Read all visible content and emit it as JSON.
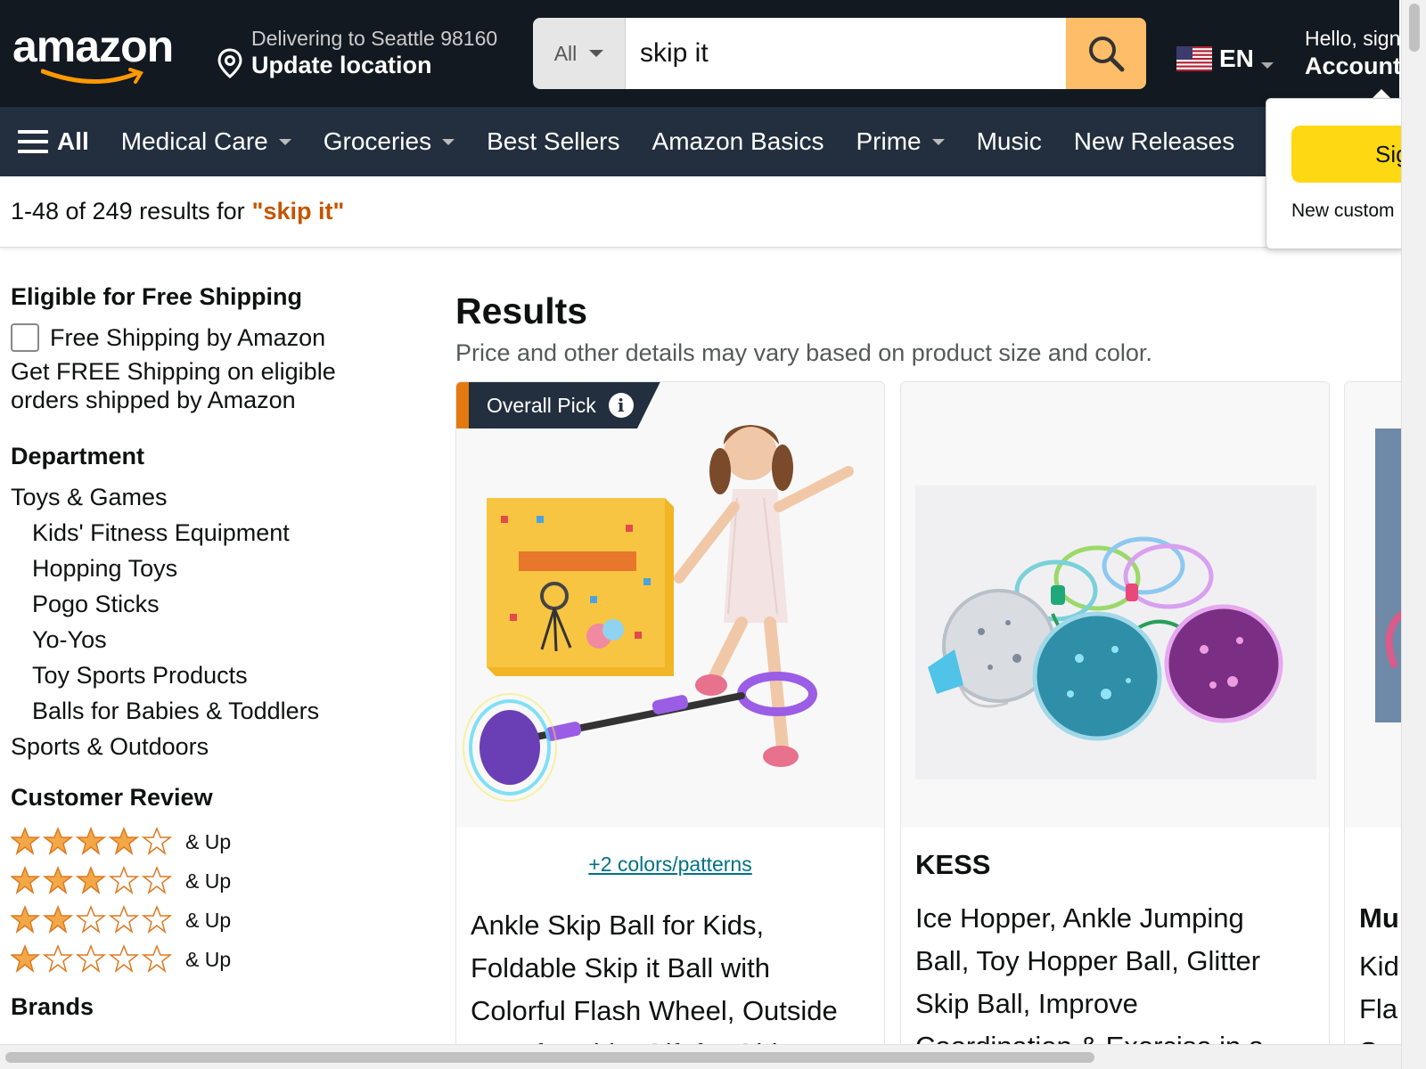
{
  "header": {
    "logo": "amazon",
    "deliver_line": "Delivering to Seattle 98160",
    "update_location": "Update location",
    "search_category": "All",
    "search_value": "skip it",
    "language": "EN",
    "greeting": "Hello, sign",
    "account": "Account"
  },
  "nav": {
    "all_label": "All",
    "items": [
      {
        "label": "Medical Care",
        "dropdown": true
      },
      {
        "label": "Groceries",
        "dropdown": true
      },
      {
        "label": "Best Sellers",
        "dropdown": false
      },
      {
        "label": "Amazon Basics",
        "dropdown": false
      },
      {
        "label": "Prime",
        "dropdown": true
      },
      {
        "label": "Music",
        "dropdown": false
      },
      {
        "label": "New Releases",
        "dropdown": false
      }
    ]
  },
  "popover": {
    "signin_button": "Sig",
    "new_customer": "New custom"
  },
  "results_bar": {
    "count_text": "1-48 of 249 results for",
    "query": "\"skip it\""
  },
  "sidebar": {
    "shipping_heading": "Eligible for Free Shipping",
    "shipping_checkbox": "Free Shipping by Amazon",
    "shipping_desc": "Get FREE Shipping on eligible orders shipped by Amazon",
    "department_heading": "Department",
    "departments": [
      {
        "label": "Toys & Games",
        "sub": false
      },
      {
        "label": "Kids' Fitness Equipment",
        "sub": true
      },
      {
        "label": "Hopping Toys",
        "sub": true
      },
      {
        "label": "Pogo Sticks",
        "sub": true
      },
      {
        "label": "Yo-Yos",
        "sub": true
      },
      {
        "label": "Toy Sports Products",
        "sub": true
      },
      {
        "label": "Balls for Babies & Toddlers",
        "sub": true
      },
      {
        "label": "Sports & Outdoors",
        "sub": false
      }
    ],
    "review_heading": "Customer Review",
    "review_rows": [
      {
        "stars": 4,
        "label": "& Up"
      },
      {
        "stars": 3,
        "label": "& Up"
      },
      {
        "stars": 2,
        "label": "& Up"
      },
      {
        "stars": 1,
        "label": "& Up"
      }
    ],
    "brands_heading": "Brands"
  },
  "results": {
    "heading": "Results",
    "subheading": "Price and other details may vary based on product size and color.",
    "products": [
      {
        "badge": "Overall Pick",
        "colors_link": "+2 colors/patterns",
        "title_lines": [
          "Ankle Skip Ball for Kids,",
          "Foldable Skip it Ball with",
          "Colorful Flash Wheel, Outside",
          "Toys for Kids, Gift for Girls &"
        ]
      },
      {
        "brand": "KESS",
        "title_lines": [
          "Ice Hopper, Ankle Jumping",
          "Ball, Toy Hopper Ball, Glitter",
          "Skip Ball, Improve",
          "Coordination & Exercise in a..."
        ]
      },
      {
        "brand": "Mu",
        "title_lines": [
          "Kid",
          "Fla",
          "S"
        ]
      }
    ]
  },
  "colors": {
    "header_bg": "#131921",
    "nav_bg": "#232f3e",
    "search_button": "#febd69",
    "query_orange": "#c45500",
    "star": "#f3a847",
    "link_teal": "#007185",
    "signin_yellow": "#ffd814"
  }
}
